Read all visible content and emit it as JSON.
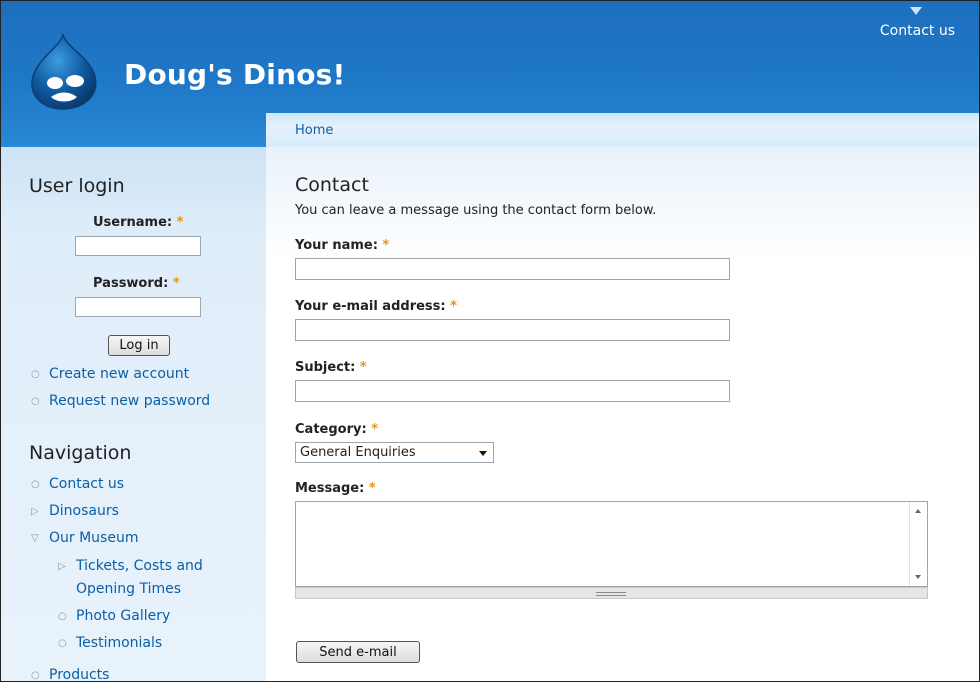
{
  "site": {
    "name": "Doug's Dinos!",
    "top_link": "Contact us"
  },
  "breadcrumb": {
    "home": "Home"
  },
  "login": {
    "title": "User login",
    "username_label": "Username:",
    "password_label": "Password:",
    "required_mark": "*",
    "username_value": "",
    "password_value": "",
    "button": "Log in",
    "links": [
      "Create new account",
      "Request new password"
    ]
  },
  "navigation": {
    "title": "Navigation",
    "items": [
      {
        "label": "Contact us",
        "marker": "○"
      },
      {
        "label": "Dinosaurs",
        "marker": "▷"
      },
      {
        "label": "Our Museum",
        "marker": "▽"
      },
      {
        "label_line1": "Tickets, Costs and",
        "label_line2": "Opening Times",
        "marker": "▷"
      },
      {
        "label": "Photo Gallery",
        "marker": "○"
      },
      {
        "label": "Testimonials",
        "marker": "○"
      },
      {
        "label": "Products",
        "marker": "○"
      }
    ]
  },
  "contact": {
    "title": "Contact",
    "intro": "You can leave a message using the contact form below.",
    "fields": {
      "name_label": "Your name:",
      "email_label": "Your e-mail address:",
      "subject_label": "Subject:",
      "category_label": "Category:",
      "message_label": "Message:"
    },
    "category_selected": "General Enquiries",
    "send_button": "Send e-mail"
  },
  "colors": {
    "header_blue": "#1f79c8",
    "link_blue": "#0b5fa5",
    "required_orange": "#e8930c"
  }
}
